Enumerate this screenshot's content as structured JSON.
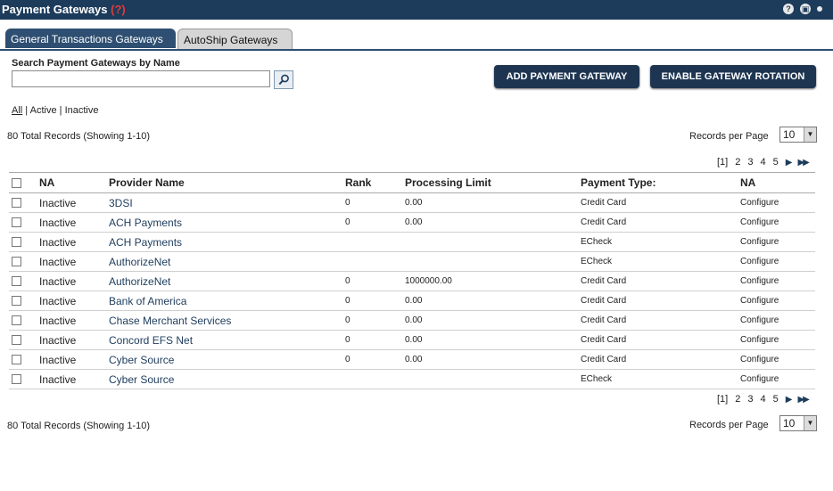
{
  "header": {
    "title": "Payment Gateways",
    "required_marker": "(?)",
    "icons": [
      "help-icon",
      "print-icon",
      "close-dot-icon"
    ]
  },
  "tabs": [
    {
      "label": "General Transactions Gateways",
      "active": true
    },
    {
      "label": "AutoShip Gateways",
      "active": false
    }
  ],
  "search": {
    "label": "Search Payment Gateways by Name",
    "value": "",
    "placeholder": ""
  },
  "actions": {
    "add_label": "ADD PAYMENT GATEWAY",
    "rotation_label": "ENABLE GATEWAY ROTATION"
  },
  "filter": {
    "all": "All",
    "sep1": " | ",
    "active": "Active",
    "sep2": " | ",
    "inactive": "Inactive"
  },
  "summary": {
    "total_text": "80 Total Records (Showing 1-10)",
    "records_per_page_label": "Records per Page",
    "records_per_page_value": "10"
  },
  "pagination": {
    "current": "[1]",
    "pages": [
      "2",
      "3",
      "4",
      "5"
    ],
    "next_icon": "next-icon",
    "last_icon": "last-icon"
  },
  "table": {
    "columns": [
      "NA",
      "Provider Name",
      "Rank",
      "Processing Limit",
      "Payment Type:",
      "NA"
    ],
    "rows": [
      {
        "status": "Inactive",
        "provider": "3DSI",
        "rank": "0",
        "limit": "0.00",
        "type": "Credit Card",
        "action": "Configure"
      },
      {
        "status": "Inactive",
        "provider": "ACH Payments",
        "rank": "0",
        "limit": "0.00",
        "type": "Credit Card",
        "action": "Configure"
      },
      {
        "status": "Inactive",
        "provider": "ACH Payments",
        "rank": "",
        "limit": "",
        "type": "ECheck",
        "action": "Configure"
      },
      {
        "status": "Inactive",
        "provider": "AuthorizeNet",
        "rank": "",
        "limit": "",
        "type": "ECheck",
        "action": "Configure"
      },
      {
        "status": "Inactive",
        "provider": "AuthorizeNet",
        "rank": "0",
        "limit": "1000000.00",
        "type": "Credit Card",
        "action": "Configure"
      },
      {
        "status": "Inactive",
        "provider": "Bank of America",
        "rank": "0",
        "limit": "0.00",
        "type": "Credit Card",
        "action": "Configure"
      },
      {
        "status": "Inactive",
        "provider": "Chase Merchant Services",
        "rank": "0",
        "limit": "0.00",
        "type": "Credit Card",
        "action": "Configure"
      },
      {
        "status": "Inactive",
        "provider": "Concord EFS Net",
        "rank": "0",
        "limit": "0.00",
        "type": "Credit Card",
        "action": "Configure"
      },
      {
        "status": "Inactive",
        "provider": "Cyber Source",
        "rank": "0",
        "limit": "0.00",
        "type": "Credit Card",
        "action": "Configure"
      },
      {
        "status": "Inactive",
        "provider": "Cyber Source",
        "rank": "",
        "limit": "",
        "type": "ECheck",
        "action": "Configure"
      }
    ]
  },
  "colors": {
    "header_bg": "#1d3c5c",
    "tab_active": "#2e4f72",
    "button_bg": "#1d3551",
    "link": "#1d3c5c",
    "required": "#e23b3b"
  }
}
